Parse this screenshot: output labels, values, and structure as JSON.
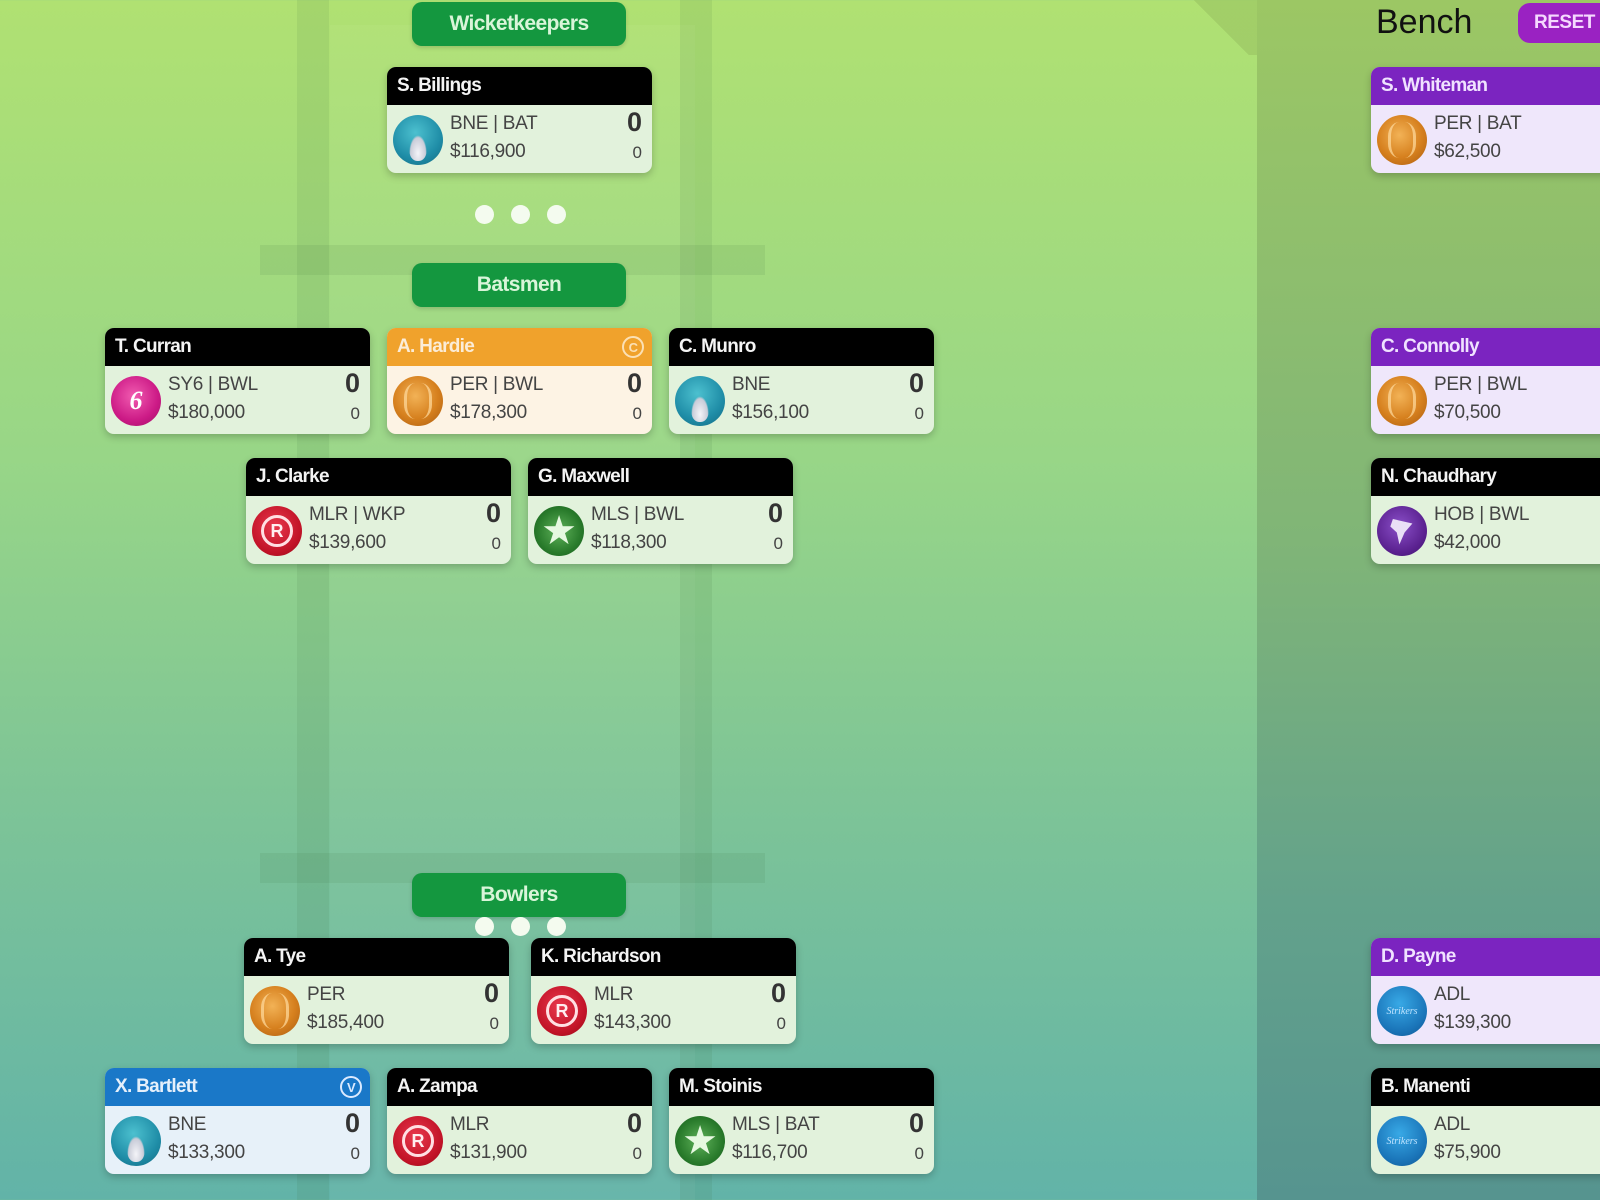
{
  "sections": {
    "wicketkeepers": "Wicketkeepers",
    "batsmen": "Batsmen",
    "bowlers": "Bowlers"
  },
  "bench": {
    "title": "Bench",
    "reset_label": "RESET"
  },
  "badges": {
    "captain": "C",
    "vice_captain": "V"
  },
  "colors": {
    "section_green": "#14973f",
    "captain_orange": "#f0a22c",
    "vice_blue": "#1a78c8",
    "bench_purple": "#7b24c0",
    "reset_purple": "#9a22c2"
  },
  "players": {
    "billings": {
      "name": "S. Billings",
      "team": "BNE | BAT",
      "price": "$116,900",
      "points": "0",
      "sub": "0",
      "logo": "bne-heat-icon"
    },
    "curran": {
      "name": "T. Curran",
      "team": "SY6 | BWL",
      "price": "$180,000",
      "points": "0",
      "sub": "0",
      "logo": "sydney-sixers-icon",
      "logo_text": "6"
    },
    "hardie": {
      "name": "A. Hardie",
      "team": "PER | BWL",
      "price": "$178,300",
      "points": "0",
      "sub": "0",
      "logo": "perth-scorchers-icon",
      "role": "captain"
    },
    "munro": {
      "name": "C. Munro",
      "team": "BNE",
      "price": "$156,100",
      "points": "0",
      "sub": "0",
      "logo": "bne-heat-icon"
    },
    "clarke": {
      "name": "J. Clarke",
      "team": "MLR | WKP",
      "price": "$139,600",
      "points": "0",
      "sub": "0",
      "logo": "melbourne-renegades-icon",
      "logo_text": "R"
    },
    "maxwell": {
      "name": "G. Maxwell",
      "team": "MLS | BWL",
      "price": "$118,300",
      "points": "0",
      "sub": "0",
      "logo": "melbourne-stars-icon",
      "logo_text": "★"
    },
    "tye": {
      "name": "A. Tye",
      "team": "PER",
      "price": "$185,400",
      "points": "0",
      "sub": "0",
      "logo": "perth-scorchers-icon"
    },
    "richardson": {
      "name": "K. Richardson",
      "team": "MLR",
      "price": "$143,300",
      "points": "0",
      "sub": "0",
      "logo": "melbourne-renegades-icon",
      "logo_text": "R"
    },
    "bartlett": {
      "name": "X. Bartlett",
      "team": "BNE",
      "price": "$133,300",
      "points": "0",
      "sub": "0",
      "logo": "bne-heat-icon",
      "role": "vice-captain"
    },
    "zampa": {
      "name": "A. Zampa",
      "team": "MLR",
      "price": "$131,900",
      "points": "0",
      "sub": "0",
      "logo": "melbourne-renegades-icon",
      "logo_text": "R"
    },
    "stoinis": {
      "name": "M. Stoinis",
      "team": "MLS | BAT",
      "price": "$116,700",
      "points": "0",
      "sub": "0",
      "logo": "melbourne-stars-icon",
      "logo_text": "★"
    }
  },
  "bench_players": {
    "whiteman": {
      "name": "S. Whiteman",
      "team": "PER | BAT",
      "price": "$62,500",
      "logo": "perth-scorchers-icon"
    },
    "connolly": {
      "name": "C. Connolly",
      "team": "PER | BWL",
      "price": "$70,500",
      "logo": "perth-scorchers-icon"
    },
    "chaudhary": {
      "name": "N. Chaudhary",
      "team": "HOB | BWL",
      "price": "$42,000",
      "logo": "hobart-hurricanes-icon"
    },
    "payne": {
      "name": "D. Payne",
      "team": "ADL",
      "price": "$139,300",
      "logo": "adelaide-strikers-icon",
      "logo_text": "Strikers"
    },
    "manenti": {
      "name": "B. Manenti",
      "team": "ADL",
      "price": "$75,900",
      "logo": "adelaide-strikers-icon",
      "logo_text": "Strikers"
    }
  }
}
